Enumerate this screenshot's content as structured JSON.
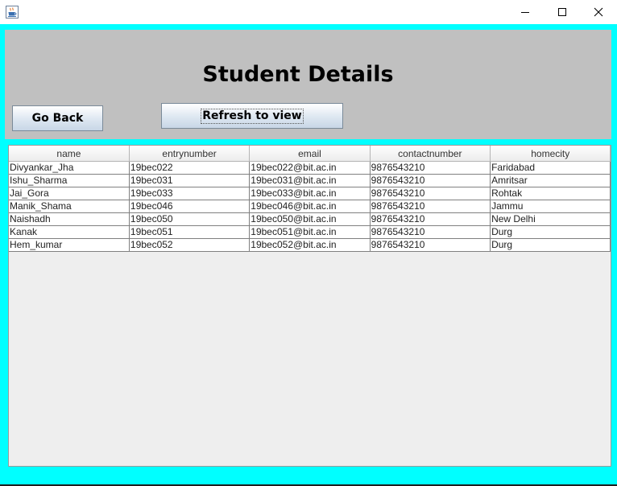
{
  "window": {
    "app_icon": "java-cup-icon",
    "controls": [
      "minimize-icon",
      "maximize-icon",
      "close-icon"
    ]
  },
  "header": {
    "title": "Student Details",
    "go_back_label": "Go Back",
    "refresh_label": "Refresh to view"
  },
  "colors": {
    "frame_background": "#00ffff",
    "header_panel": "#c0c0c0",
    "table_background": "#eeeeee"
  },
  "table": {
    "columns": [
      "name",
      "entrynumber",
      "email",
      "contactnumber",
      "homecity"
    ],
    "rows": [
      [
        "Divyankar_Jha",
        "19bec022",
        "19bec022@bit.ac.in",
        "9876543210",
        "Faridabad"
      ],
      [
        "Ishu_Sharma",
        "19bec031",
        "19bec031@bit.ac.in",
        "9876543210",
        "Amritsar"
      ],
      [
        "Jai_Gora",
        "19bec033",
        "19bec033@bit.ac.in",
        "9876543210",
        "Rohtak"
      ],
      [
        "Manik_Shama",
        "19bec046",
        "19bec046@bit.ac.in",
        "9876543210",
        "Jammu"
      ],
      [
        "Naishadh",
        "19bec050",
        "19bec050@bit.ac.in",
        "9876543210",
        "New Delhi"
      ],
      [
        "Kanak",
        "19bec051",
        "19bec051@bit.ac.in",
        "9876543210",
        "Durg"
      ],
      [
        "Hem_kumar",
        "19bec052",
        "19bec052@bit.ac.in",
        "9876543210",
        "Durg"
      ]
    ]
  }
}
